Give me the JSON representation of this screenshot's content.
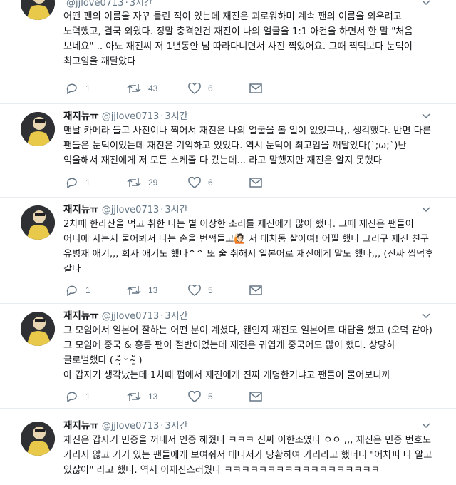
{
  "tweets": [
    {
      "name": "",
      "handle": "@jjlove0713",
      "time": "3시간",
      "text": "어떤 팬의 이름을 자꾸 틀린 적이 있는데 재진은 괴로워하며 계속 팬의 이름을 외우려고 노력했고, 결국 외웠다. 정말 충격인건 재진이 나의 얼굴을 1:1 아컨을 하면서 한 말 \"처음 보네요\" .. 아뇨 재진씨 저 1년동안 님 따라다니면서 사진 찍었어요. 그때 찍덕보다 눈덕이 최고임을 깨달았다",
      "replies": "1",
      "retweets": "43",
      "likes": "6"
    },
    {
      "name": "재지뉴ㅠ",
      "handle": "@jjlove0713",
      "time": "3시간",
      "text": "맨날 카메라 들고 사진이나 찍어서 재진은 나의 얼굴을 볼 일이 없었구나,, 생각했다. 반면 다른 팬들은 눈덕이었는데 재진은 기억하고 있었다. 역시 눈덕이 최고임을 깨달았다(`;ω;`)난 억울해서 재진에게 저 모든 스케줄 다 갔는데... 라고 말했지만 재진은 알지 못했다",
      "replies": "1",
      "retweets": "29",
      "likes": "6"
    },
    {
      "name": "재지뉴ㅠ",
      "handle": "@jjlove0713",
      "time": "3시간",
      "text": "2차때 한라산을 먹고 취한 나는 별 이상한 소리를 재진에게 많이 했다. 그때 재진은 팬들이 어디에 사는지 물어봐서 나는 손을 번쩍들고🙋🏻 저 대치동 살아여! 어필 했다 그리구 재진 친구 유병재 애기,,, 회사 애기도 했다^^ 또 술 취해서 일본어로 재진에게 말도 했다,,, (진짜 씹덕후 같다",
      "replies": "1",
      "retweets": "13",
      "likes": "5"
    },
    {
      "name": "재지뉴ㅠ",
      "handle": "@jjlove0713",
      "time": "3시간",
      "text": "그 모임에서 일본어 잘하는 어떤 분이 계셨다, 왠인지 재진도 일본어로 대답을 했고 (오덕 같아) 그 모임에 중국 & 홍콩 팬이 절반이었는데 재진은 귀엽게 중국어도 많이 했다. 상당히 글로벌했다 ( ˘̴͈́ ᵕ ˘̴͈̀ )\n아 갑자기 생각났는데 1차때 펍에서 재진에게 진짜 개명한거냐고 팬들이 물어보니까",
      "replies": "1",
      "retweets": "13",
      "likes": "5"
    },
    {
      "name": "재지뉴ㅠ",
      "handle": "@jjlove0713",
      "time": "3시간",
      "text": "재진은 갑자기 민증을 꺼내서 인증 해줬다 ㅋㅋㅋ 진짜 이한조였다 ㅇㅇ ,,, 재진은 민증 번호도 가리지 않고 거기 있는 팬들에게 보여줘서 매니저가 당황하여 가리라고 했더니 \"어차피 다 알고 있잖아\" 라고 했다. 역시 이재진스러웠다 ㅋㅋㅋㅋㅋㅋㅋㅋㅋㅋㅋㅋㅋㅋㅋㅋㅋㅋ",
      "replies": "",
      "retweets": "",
      "likes": ""
    }
  ],
  "icons": {
    "reply": "reply-icon",
    "retweet": "retweet-icon",
    "like": "heart-icon",
    "dm": "envelope-icon",
    "more": "chevron-down-icon"
  },
  "colors": {
    "muted": "#657786",
    "divider": "#e6ecf0",
    "text": "#14171a"
  }
}
